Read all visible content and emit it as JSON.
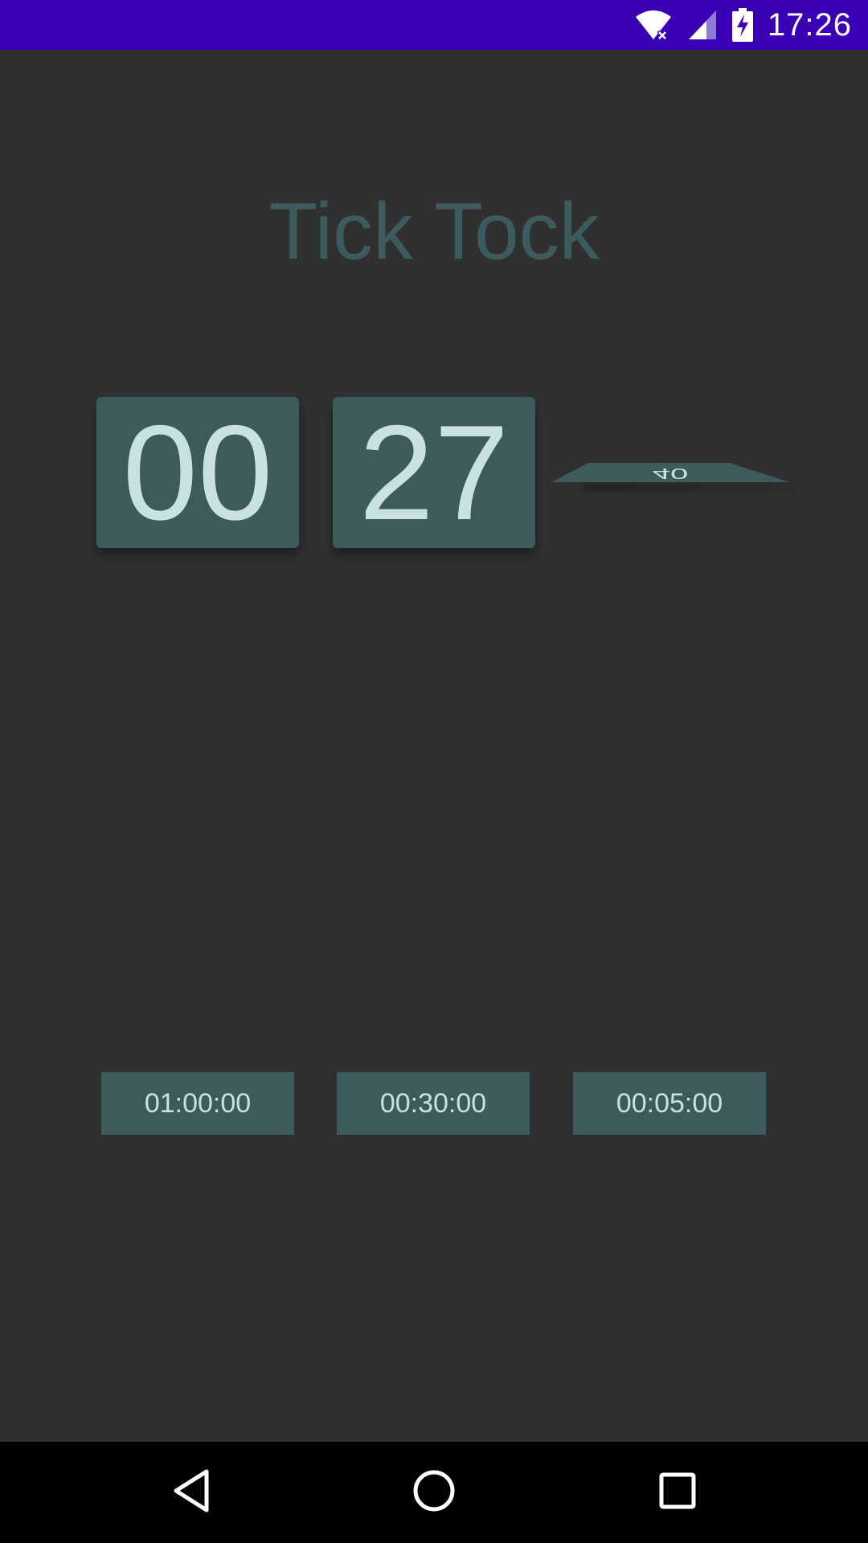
{
  "status_bar": {
    "time": "17:26",
    "icons": [
      "wifi-icon",
      "signal-icon",
      "battery-charging-icon"
    ],
    "background": "#3a00b5"
  },
  "app": {
    "title": "Tick Tock",
    "title_color": "#3d5a5c",
    "background": "#303030"
  },
  "clock": {
    "hours": "00",
    "minutes": "27",
    "seconds_flipping": "40",
    "card_color": "#3d5a5c",
    "digit_color": "#c7e2e0"
  },
  "presets": [
    {
      "label": "01:00:00"
    },
    {
      "label": "00:30:00"
    },
    {
      "label": "00:05:00"
    }
  ],
  "nav_bar": {
    "icons": [
      "back-icon",
      "home-icon",
      "recents-icon"
    ]
  }
}
